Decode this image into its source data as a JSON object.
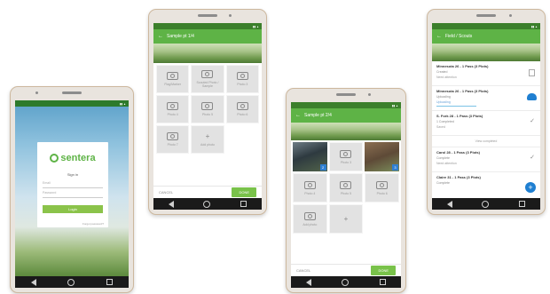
{
  "login": {
    "brand": "sentera",
    "heading": "Sign in",
    "email_placeholder": "Email",
    "password_placeholder": "Password",
    "login_label": "Login",
    "forgot_label": "Forgot password?"
  },
  "photos": {
    "title": "Sample pt 1/4",
    "tiles": [
      "Flag/Marker",
      "Scouted Photo / Sample",
      "Photo 3",
      "Photo 4",
      "Photo 5",
      "Photo 6",
      "Photo 7",
      "Add photo"
    ],
    "cancel_label": "CANCEL",
    "done_label": "DONE"
  },
  "photos2": {
    "title": "Sample pt 2/4",
    "badges": [
      "2",
      "3"
    ],
    "tiles": [
      "Photo 3",
      "Photo 4",
      "Photo 5",
      "Photo 6",
      "Add photo"
    ],
    "cancel_label": "CANCEL",
    "done_label": "DONE"
  },
  "list": {
    "title": "Field / Scouts",
    "rows": [
      {
        "title": "Minnesota 26 - 1 Pass (3 Plots)",
        "sub": "Created",
        "stat": "Need attention"
      },
      {
        "title": "Minnesota 26 - 1 Pass (3 Plots)",
        "sub": "Uploading",
        "stat": "Uploading"
      },
      {
        "title": "S. Fork 28 - 1 Pass (3 Plots)",
        "sub": "1 Completed",
        "stat": "Saved"
      },
      {
        "title": "Carol 28 - 1 Pass (3 Plots)",
        "sub": "Complete",
        "stat": "Need attention"
      },
      {
        "title": "Claire 31 - 1 Pass (3 Plots)",
        "sub": "Complete",
        "stat": ""
      }
    ],
    "divider_label": "View completed"
  },
  "colors": {
    "accent": "#5eb346",
    "status": "#3b7f2b",
    "upload": "#1f7fd1",
    "done": "#79c24a"
  }
}
